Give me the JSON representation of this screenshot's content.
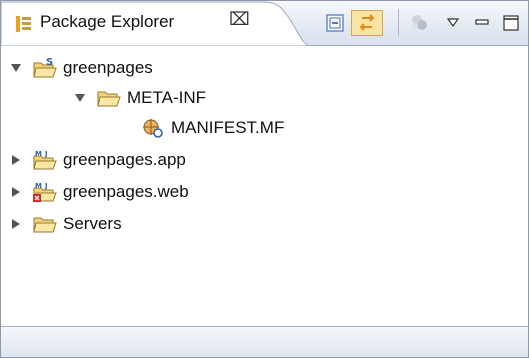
{
  "view": {
    "title": "Package Explorer",
    "close_glyph": "⌧",
    "icon": "package-explorer-icon",
    "accent": "#e7a21f"
  },
  "toolbar": {
    "buttons": [
      {
        "name": "collapse-all-icon"
      },
      {
        "name": "link-with-editor-icon"
      },
      {
        "name": "focus-on-active-task-icon"
      },
      {
        "name": "view-menu-icon"
      },
      {
        "name": "minimize-icon"
      },
      {
        "name": "maximize-icon"
      }
    ]
  },
  "tree": {
    "items": [
      {
        "label": "greenpages",
        "expanded": true,
        "depth": 0,
        "icon": "project-folder-icon"
      },
      {
        "label": "META-INF",
        "expanded": true,
        "depth": 1,
        "icon": "folder-icon"
      },
      {
        "label": "MANIFEST.MF",
        "depth": 2,
        "icon": "manifest-file-icon"
      },
      {
        "label": "greenpages.app",
        "expanded": false,
        "depth": 0,
        "icon": "bundle-project-icon"
      },
      {
        "label": "greenpages.web",
        "expanded": false,
        "depth": 0,
        "icon": "bundle-project-error-icon"
      },
      {
        "label": "Servers",
        "expanded": false,
        "depth": 0,
        "icon": "folder-icon"
      }
    ]
  }
}
